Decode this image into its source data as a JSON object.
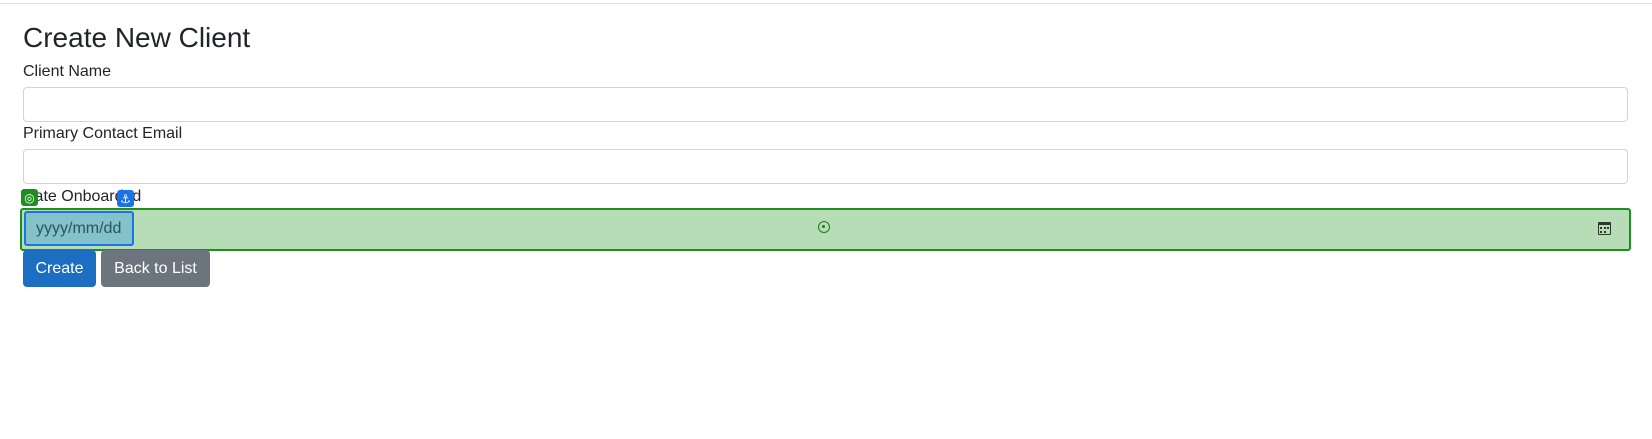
{
  "page": {
    "title": "Create New Client"
  },
  "form": {
    "client_name_label": "Client Name",
    "client_name_value": "",
    "email_label": "Primary Contact Email",
    "email_value": "",
    "date_label": "Date Onboarded",
    "date_placeholder": "yyyy/mm/dd"
  },
  "buttons": {
    "create": "Create",
    "back": "Back to List"
  },
  "overlay": {
    "target_badge_icon": "target-icon",
    "anchor_badge_icon": "anchor-icon"
  },
  "colors": {
    "primary": "#1b6ec2",
    "secondary": "#6c757d",
    "highlight_green": "#1e8e1e",
    "highlight_fill": "#b6ddb6",
    "highlight_blue": "#1a73e8"
  }
}
